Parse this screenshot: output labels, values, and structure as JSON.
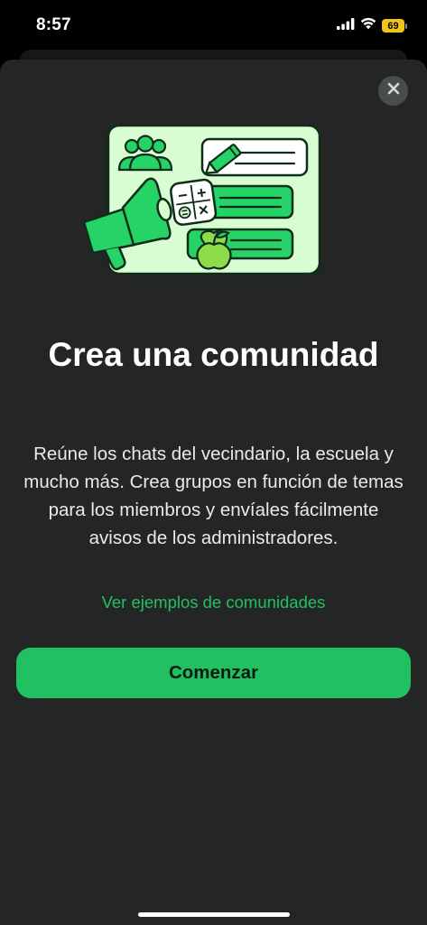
{
  "status_bar": {
    "time": "8:57",
    "battery_level": "69",
    "icons": [
      "signal-bars-icon",
      "wifi-icon",
      "battery-icon"
    ]
  },
  "sheet": {
    "close_icon": "close-icon",
    "illustration_icon": "community-illustration-icon",
    "title": "Crea una comunidad",
    "description": "Reúne los chats del vecindario, la escuela y mucho más. Crea grupos en función de temas para los miembros y envíales fácilmente avisos de los administradores.",
    "examples_link": "Ver ejemplos de comunidades",
    "primary_button": "Comenzar"
  },
  "colors": {
    "accent": "#21c062",
    "link": "#23c15e",
    "sheet_background": "#242626",
    "battery": "#f2c318"
  }
}
